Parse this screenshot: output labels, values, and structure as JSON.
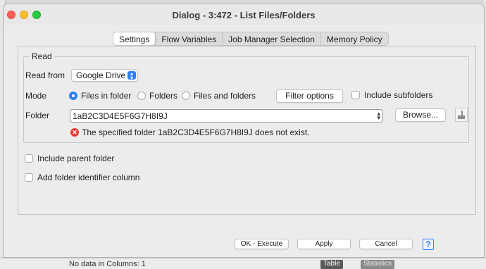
{
  "window": {
    "title": "Dialog - 3:472 - List Files/Folders"
  },
  "tabs": [
    {
      "label": "Settings",
      "active": true
    },
    {
      "label": "Flow Variables",
      "active": false
    },
    {
      "label": "Job Manager Selection",
      "active": false
    },
    {
      "label": "Memory Policy",
      "active": false
    }
  ],
  "read": {
    "legend": "Read",
    "read_from_label": "Read from",
    "read_from_value": "Google Drive",
    "mode_label": "Mode",
    "mode_options": [
      {
        "label": "Files in folder",
        "selected": true
      },
      {
        "label": "Folders",
        "selected": false
      },
      {
        "label": "Files and folders",
        "selected": false
      }
    ],
    "filter_button": "Filter options",
    "include_subfolders": "Include subfolders",
    "folder_label": "Folder",
    "folder_value": "1aB2C3D4E5F6G7H8I9J",
    "browse_button": "Browse...",
    "error_message": "The specified folder 1aB2C3D4E5F6G7H8I9J does not exist."
  },
  "options": {
    "include_parent": "Include parent folder",
    "add_identifier": "Add folder identifier column"
  },
  "buttons": {
    "ok": "OK - Execute",
    "apply": "Apply",
    "cancel": "Cancel",
    "help": "?"
  },
  "background": {
    "fragment_text": "No data in Columns: 1",
    "table_tab": "Table",
    "stats_tab": "Statistics"
  },
  "colors": {
    "accent": "#2f7ef6",
    "error": "#e53935"
  }
}
